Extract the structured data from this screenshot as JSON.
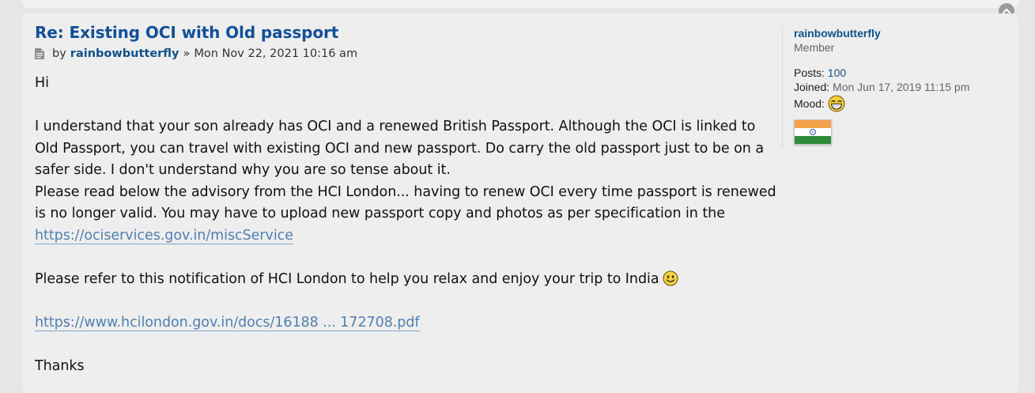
{
  "post": {
    "title": "Re: Existing OCI with Old passport",
    "by_label": "by",
    "author": "rainbowbutterfly",
    "separator": "»",
    "datetime": "Mon Nov 22, 2021 10:16 am",
    "body": {
      "greeting": "Hi",
      "paragraph1": "I understand that your son already has OCI and a renewed British Passport. Although the OCI is linked to Old Passport, you can travel with existing OCI and new passport. Do carry the old passport just to be on a safer side. I don't understand why you are so tense about it.",
      "paragraph2_prefix": "Please read below the advisory from the HCI London... having to renew OCI every time passport is renewed is no longer valid. You may have to upload new passport copy and photos as per specification in the",
      "link1_text": "https://ociservices.gov.in/miscService",
      "paragraph3": "Please refer to this notification of HCI London to help you relax and enjoy your trip to India",
      "link2_text": "https://www.hcilondon.gov.in/docs/16188 ... 172708.pdf",
      "closing": "Thanks"
    }
  },
  "profile": {
    "username": "rainbowbutterfly",
    "rank": "Member",
    "posts_label": "Posts:",
    "posts_value": "100",
    "joined_label": "Joined:",
    "joined_value": "Mon Jun 17, 2019 11:15 pm",
    "mood_label": "Mood:",
    "mood_icon": "grinning-face-icon",
    "flag_icon": "india-flag-icon"
  },
  "icons": {
    "post_icon": "document-icon",
    "back_to_top": "chevron-up-icon",
    "inline_smiley": "smiley-icon"
  },
  "colors": {
    "link_blue": "#115098",
    "username_blue": "#105289",
    "url_blue": "#4f7fb0",
    "post_bg": "#eeeeee",
    "page_bg": "#e6e6e6"
  }
}
